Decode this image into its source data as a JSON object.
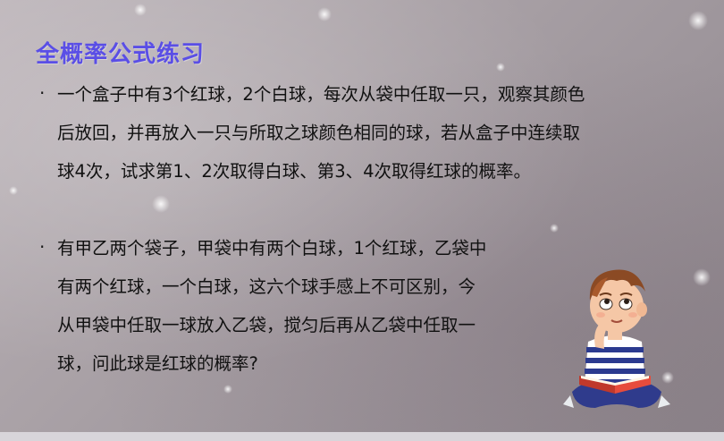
{
  "title": "全概率公式练习",
  "bullet_mark": "·",
  "question1": {
    "lines": [
      "一个盒子中有3个红球，2个白球，每次从袋中任取一只，观察其颜色",
      "后放回，并再放入一只与所取之球颜色相同的球，若从盒子中连续取",
      "球4次，试求第1、2次取得白球、第3、4次取得红球的概率。"
    ]
  },
  "question2": {
    "lines": [
      "有甲乙两个袋子，甲袋中有两个白球，1个红球，乙袋中",
      "有两个红球，一个白球，这六个球手感上不可区别，今",
      "从甲袋中任取一球放入乙袋，搅匀后再从乙袋中任取一",
      "球，问此球是红球的概率?"
    ]
  },
  "colors": {
    "title": "#5a4ee6",
    "text": "#111111"
  },
  "illustration": "boy-reading-book-illustration"
}
